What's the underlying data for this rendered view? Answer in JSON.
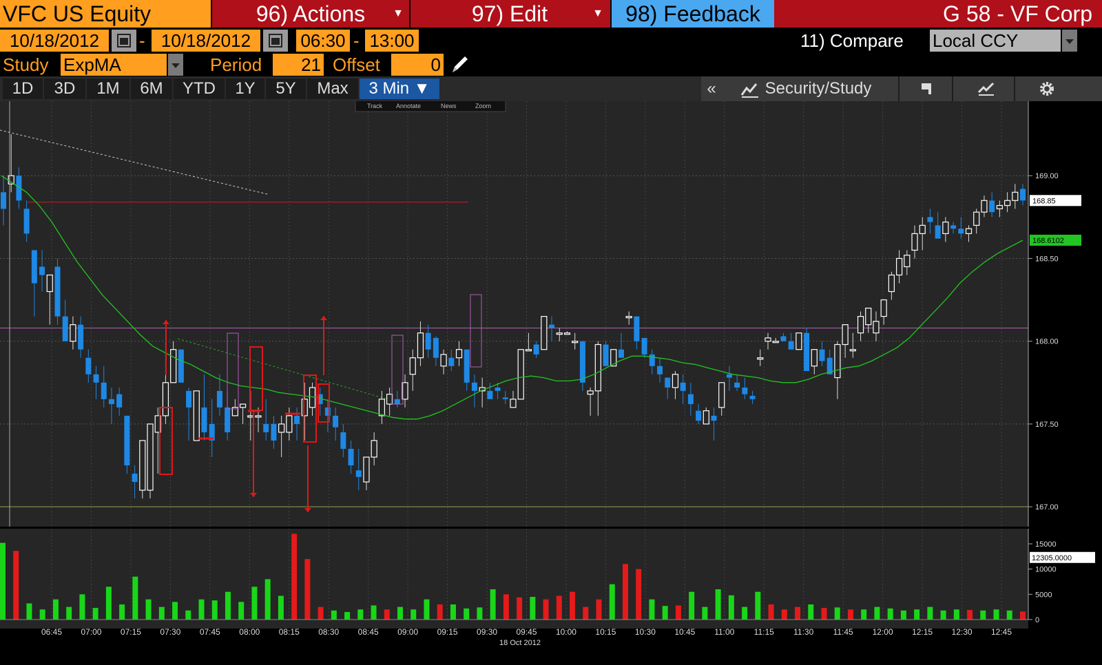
{
  "header": {
    "ticker": "VFC US Equity",
    "actions": "96) Actions",
    "edit": "97) Edit",
    "feedback": "98) Feedback",
    "corp": "G 58 - VF Corp"
  },
  "range": {
    "start_date": "10/18/2012",
    "dash1": "-",
    "end_date": "10/18/2012",
    "start_time": "06:30",
    "dash2": "-",
    "end_time": "13:00",
    "compare": "11) Compare",
    "currency": "Local CCY"
  },
  "study": {
    "label": "Study",
    "value": "ExpMA",
    "period_label": "Period",
    "period": "21",
    "offset_label": "Offset",
    "offset": "0"
  },
  "tabs": [
    "1D",
    "3D",
    "1M",
    "6M",
    "YTD",
    "1Y",
    "5Y",
    "Max",
    "3 Min ▼"
  ],
  "tools": {
    "collapse": "«",
    "security_study": "Security/Study"
  },
  "mini_toolbar": [
    "Track",
    "Annotate",
    "News",
    "Zoom"
  ],
  "colors": {
    "up": "#ffffff",
    "down": "#1e88e5",
    "ema": "#22c522",
    "vol_up": "#19d619",
    "vol_down": "#e51a1a",
    "annotation": "#e01818"
  },
  "chart_data": {
    "type": "candlestick",
    "x_ticks": [
      "06:45",
      "07:00",
      "07:15",
      "07:30",
      "07:45",
      "08:00",
      "08:15",
      "08:30",
      "08:45",
      "09:00",
      "09:15",
      "09:30",
      "09:45",
      "10:00",
      "10:15",
      "10:30",
      "10:45",
      "11:00",
      "11:15",
      "11:30",
      "11:45",
      "12:00",
      "12:15",
      "12:30",
      "12:45"
    ],
    "x_date_label": "18 Oct 2012",
    "y_ticks": [
      "169.00",
      "168.50",
      "168.00",
      "167.50",
      "167.00"
    ],
    "ylim": [
      166.88,
      169.45
    ],
    "last_price": "168.85",
    "ema_last": "168.6102",
    "volume_ticks": [
      "15000",
      "10000",
      "5000",
      "0"
    ],
    "volume_last": "12305.0000",
    "volume_ylim": [
      0,
      18000
    ],
    "candles_ohlc": [
      [
        168.9,
        169.0,
        168.7,
        168.8
      ],
      [
        168.95,
        169.25,
        168.9,
        169.0
      ],
      [
        169.0,
        169.05,
        168.8,
        168.85
      ],
      [
        168.8,
        168.85,
        168.6,
        168.65
      ],
      [
        168.55,
        168.55,
        168.15,
        168.35
      ],
      [
        168.45,
        168.55,
        168.3,
        168.4
      ],
      [
        168.3,
        168.4,
        168.1,
        168.4
      ],
      [
        168.45,
        168.5,
        168.1,
        168.15
      ],
      [
        168.15,
        168.25,
        168.0,
        168.0
      ],
      [
        168.0,
        168.15,
        167.95,
        168.1
      ],
      [
        168.1,
        168.15,
        167.9,
        167.95
      ],
      [
        167.9,
        167.95,
        167.75,
        167.8
      ],
      [
        167.8,
        167.85,
        167.65,
        167.75
      ],
      [
        167.75,
        167.85,
        167.6,
        167.65
      ],
      [
        167.65,
        167.72,
        167.5,
        167.62
      ],
      [
        167.68,
        167.72,
        167.55,
        167.6
      ],
      [
        167.55,
        167.55,
        167.2,
        167.25
      ],
      [
        167.2,
        167.25,
        167.05,
        167.15
      ],
      [
        167.1,
        167.4,
        167.05,
        167.4
      ],
      [
        167.1,
        167.5,
        167.05,
        167.5
      ],
      [
        167.45,
        167.6,
        167.2,
        167.55
      ],
      [
        167.55,
        168.0,
        167.5,
        167.75
      ],
      [
        167.75,
        168.0,
        167.75,
        167.95
      ],
      [
        167.95,
        167.95,
        167.75,
        167.75
      ],
      [
        167.7,
        167.72,
        167.4,
        167.6
      ],
      [
        167.4,
        167.7,
        167.4,
        167.7
      ],
      [
        167.6,
        167.8,
        167.4,
        167.45
      ],
      [
        167.5,
        167.65,
        167.3,
        167.4
      ],
      [
        167.7,
        167.8,
        167.55,
        167.6
      ],
      [
        167.6,
        167.7,
        167.4,
        167.45
      ],
      [
        167.55,
        167.65,
        167.55,
        167.6
      ],
      [
        167.6,
        167.62,
        167.5,
        167.62
      ],
      [
        167.55,
        167.7,
        167.4,
        167.55
      ],
      [
        167.55,
        167.6,
        167.45,
        167.55
      ],
      [
        167.5,
        167.65,
        167.4,
        167.45
      ],
      [
        167.5,
        167.55,
        167.35,
        167.4
      ],
      [
        167.45,
        167.55,
        167.3,
        167.5
      ],
      [
        167.45,
        167.6,
        167.4,
        167.55
      ],
      [
        167.55,
        167.6,
        167.4,
        167.5
      ],
      [
        167.55,
        167.75,
        167.4,
        167.65
      ],
      [
        167.6,
        167.75,
        167.55,
        167.72
      ],
      [
        167.68,
        167.72,
        167.55,
        167.62
      ],
      [
        167.6,
        167.65,
        167.45,
        167.55
      ],
      [
        167.55,
        167.6,
        167.4,
        167.48
      ],
      [
        167.45,
        167.5,
        167.3,
        167.35
      ],
      [
        167.35,
        167.4,
        167.2,
        167.25
      ],
      [
        167.22,
        167.35,
        167.1,
        167.18
      ],
      [
        167.15,
        167.3,
        167.1,
        167.3
      ],
      [
        167.3,
        167.45,
        167.25,
        167.4
      ],
      [
        167.55,
        167.7,
        167.5,
        167.65
      ],
      [
        167.62,
        167.72,
        167.55,
        167.68
      ],
      [
        167.65,
        167.7,
        167.6,
        167.62
      ],
      [
        167.65,
        167.8,
        167.6,
        167.75
      ],
      [
        167.8,
        167.95,
        167.7,
        167.9
      ],
      [
        167.9,
        168.12,
        167.85,
        168.05
      ],
      [
        168.05,
        168.1,
        167.9,
        167.95
      ],
      [
        168.02,
        168.03,
        167.85,
        167.9
      ],
      [
        167.85,
        167.95,
        167.8,
        167.92
      ],
      [
        167.9,
        167.95,
        167.82,
        167.85
      ],
      [
        167.9,
        168.0,
        167.85,
        167.95
      ],
      [
        167.95,
        167.95,
        167.7,
        167.75
      ],
      [
        167.75,
        167.8,
        167.6,
        167.7
      ],
      [
        167.7,
        167.78,
        167.6,
        167.72
      ],
      [
        167.7,
        167.75,
        167.65,
        167.65
      ],
      [
        167.72,
        167.75,
        167.65,
        167.7
      ],
      [
        167.66,
        167.7,
        167.62,
        167.65
      ],
      [
        167.6,
        167.7,
        167.6,
        167.65
      ],
      [
        167.65,
        167.95,
        167.65,
        167.95
      ],
      [
        167.95,
        168.05,
        167.95,
        167.95
      ],
      [
        167.98,
        168.0,
        167.9,
        167.92
      ],
      [
        167.95,
        168.15,
        167.95,
        168.15
      ],
      [
        168.1,
        168.15,
        168.0,
        168.08
      ],
      [
        168.05,
        168.08,
        168.0,
        168.05
      ],
      [
        168.05,
        168.06,
        168.05,
        168.05
      ],
      [
        168.0,
        168.05,
        167.95,
        168.0
      ],
      [
        168.0,
        168.0,
        167.7,
        167.75
      ],
      [
        167.68,
        167.72,
        167.55,
        167.7
      ],
      [
        167.7,
        168.0,
        167.55,
        167.98
      ],
      [
        167.98,
        168.0,
        167.85,
        167.85
      ],
      [
        167.85,
        167.95,
        167.85,
        167.95
      ],
      [
        167.95,
        168.05,
        167.9,
        167.9
      ],
      [
        168.15,
        168.18,
        168.1,
        168.15
      ],
      [
        168.15,
        168.15,
        167.95,
        168.0
      ],
      [
        168.02,
        168.02,
        167.9,
        167.92
      ],
      [
        167.92,
        167.95,
        167.8,
        167.85
      ],
      [
        167.85,
        167.9,
        167.75,
        167.8
      ],
      [
        167.78,
        167.78,
        167.65,
        167.72
      ],
      [
        167.72,
        167.82,
        167.65,
        167.8
      ],
      [
        167.75,
        167.8,
        167.62,
        167.7
      ],
      [
        167.68,
        167.75,
        167.55,
        167.62
      ],
      [
        167.58,
        167.62,
        167.5,
        167.52
      ],
      [
        167.5,
        167.6,
        167.5,
        167.58
      ],
      [
        167.55,
        167.6,
        167.4,
        167.52
      ],
      [
        167.6,
        167.75,
        167.55,
        167.75
      ],
      [
        167.8,
        167.85,
        167.7,
        167.78
      ],
      [
        167.75,
        167.8,
        167.7,
        167.72
      ],
      [
        167.72,
        167.78,
        167.65,
        167.68
      ],
      [
        167.67,
        167.7,
        167.62,
        167.65
      ],
      [
        167.9,
        167.95,
        167.85,
        167.9
      ],
      [
        168.0,
        168.05,
        167.95,
        168.02
      ],
      [
        168.0,
        168.02,
        168.0,
        168.0
      ],
      [
        168.03,
        168.05,
        168.0,
        168.0
      ],
      [
        168.0,
        168.05,
        167.95,
        167.95
      ],
      [
        167.95,
        168.05,
        167.95,
        168.05
      ],
      [
        168.05,
        168.08,
        167.82,
        167.82
      ],
      [
        167.85,
        167.95,
        167.8,
        167.95
      ],
      [
        167.95,
        168.0,
        167.85,
        167.88
      ],
      [
        167.9,
        167.95,
        167.8,
        167.8
      ],
      [
        167.78,
        168.0,
        167.65,
        167.98
      ],
      [
        167.98,
        168.1,
        167.9,
        168.1
      ],
      [
        167.95,
        168.05,
        167.9,
        167.95
      ],
      [
        168.05,
        168.18,
        168.0,
        168.15
      ],
      [
        168.1,
        168.2,
        168.05,
        168.2
      ],
      [
        168.05,
        168.18,
        168.0,
        168.12
      ],
      [
        168.15,
        168.25,
        168.1,
        168.25
      ],
      [
        168.3,
        168.42,
        168.25,
        168.4
      ],
      [
        168.4,
        168.55,
        168.35,
        168.5
      ],
      [
        168.45,
        168.55,
        168.4,
        168.52
      ],
      [
        168.55,
        168.7,
        168.5,
        168.65
      ],
      [
        168.65,
        168.75,
        168.55,
        168.7
      ],
      [
        168.75,
        168.8,
        168.65,
        168.72
      ],
      [
        168.7,
        168.78,
        168.62,
        168.62
      ],
      [
        168.65,
        168.75,
        168.6,
        168.72
      ],
      [
        168.7,
        168.72,
        168.65,
        168.68
      ],
      [
        168.68,
        168.75,
        168.62,
        168.65
      ],
      [
        168.65,
        168.7,
        168.6,
        168.68
      ],
      [
        168.7,
        168.8,
        168.65,
        168.78
      ],
      [
        168.78,
        168.88,
        168.75,
        168.85
      ],
      [
        168.85,
        168.9,
        168.75,
        168.78
      ],
      [
        168.8,
        168.85,
        168.75,
        168.82
      ],
      [
        168.82,
        168.9,
        168.78,
        168.85
      ],
      [
        168.85,
        168.95,
        168.8,
        168.9
      ],
      [
        168.92,
        168.95,
        168.82,
        168.85
      ]
    ],
    "ema_series": [
      169.0,
      168.95,
      168.9,
      168.82,
      168.72,
      168.6,
      168.48,
      168.38,
      168.28,
      168.2,
      168.12,
      168.04,
      167.97,
      167.93,
      167.89,
      167.86,
      167.82,
      167.78,
      167.75,
      167.73,
      167.72,
      167.71,
      167.69,
      167.68,
      167.67,
      167.66,
      167.64,
      167.62,
      167.6,
      167.58,
      167.56,
      167.54,
      167.53,
      167.53,
      167.55,
      167.58,
      167.62,
      167.66,
      167.7,
      167.73,
      167.76,
      167.78,
      167.79,
      167.78,
      167.76,
      167.76,
      167.77,
      167.8,
      167.84,
      167.88,
      167.91,
      167.91,
      167.9,
      167.89,
      167.87,
      167.86,
      167.84,
      167.82,
      167.8,
      167.79,
      167.78,
      167.76,
      167.75,
      167.75,
      167.77,
      167.8,
      167.82,
      167.84,
      167.85,
      167.88,
      167.92,
      167.96,
      168.02,
      168.1,
      168.18,
      168.26,
      168.35,
      168.42,
      168.48,
      168.53,
      168.57,
      168.61
    ],
    "volume_up_down": [
      [
        15200,
        0
      ],
      [
        0,
        13600
      ],
      [
        3200,
        0
      ],
      [
        2000,
        0
      ],
      [
        4000,
        0
      ],
      [
        2500,
        0
      ],
      [
        5000,
        0
      ],
      [
        2300,
        0
      ],
      [
        6500,
        0
      ],
      [
        3000,
        0
      ],
      [
        8500,
        0
      ],
      [
        4000,
        0
      ],
      [
        2500,
        0
      ],
      [
        3500,
        0
      ],
      [
        1800,
        0
      ],
      [
        4000,
        0
      ],
      [
        3800,
        0
      ],
      [
        5500,
        0
      ],
      [
        3500,
        0
      ],
      [
        6500,
        0
      ],
      [
        8000,
        0
      ],
      [
        4700,
        0
      ],
      [
        0,
        17000
      ],
      [
        0,
        12000
      ],
      [
        0,
        2500
      ],
      [
        1800,
        0
      ],
      [
        1500,
        0
      ],
      [
        2000,
        0
      ],
      [
        2800,
        0
      ],
      [
        0,
        2000
      ],
      [
        2500,
        0
      ],
      [
        2000,
        0
      ],
      [
        4000,
        0
      ],
      [
        0,
        3000
      ],
      [
        3000,
        0
      ],
      [
        2200,
        0
      ],
      [
        2400,
        0
      ],
      [
        6000,
        0
      ],
      [
        0,
        5000
      ],
      [
        0,
        4400
      ],
      [
        4500,
        0
      ],
      [
        0,
        4000
      ],
      [
        0,
        4700
      ],
      [
        0,
        5500
      ],
      [
        0,
        2500
      ],
      [
        0,
        4000
      ],
      [
        7000,
        0
      ],
      [
        0,
        11000
      ],
      [
        0,
        10000
      ],
      [
        4000,
        0
      ],
      [
        2700,
        0
      ],
      [
        0,
        2800
      ],
      [
        5500,
        0
      ],
      [
        2500,
        0
      ],
      [
        6000,
        0
      ],
      [
        4800,
        0
      ],
      [
        2500,
        0
      ],
      [
        5500,
        0
      ],
      [
        0,
        3000
      ],
      [
        0,
        2000
      ],
      [
        0,
        2500
      ],
      [
        3000,
        0
      ],
      [
        0,
        2300
      ],
      [
        2400,
        0
      ],
      [
        0,
        2000
      ],
      [
        2000,
        0
      ],
      [
        2500,
        0
      ],
      [
        2200,
        0
      ],
      [
        1800,
        0
      ],
      [
        2000,
        0
      ],
      [
        2500,
        0
      ],
      [
        1800,
        0
      ],
      [
        2000,
        0
      ],
      [
        0,
        1900
      ],
      [
        1800,
        0
      ],
      [
        2000,
        0
      ],
      [
        1800,
        0
      ],
      [
        0,
        1600
      ]
    ]
  }
}
